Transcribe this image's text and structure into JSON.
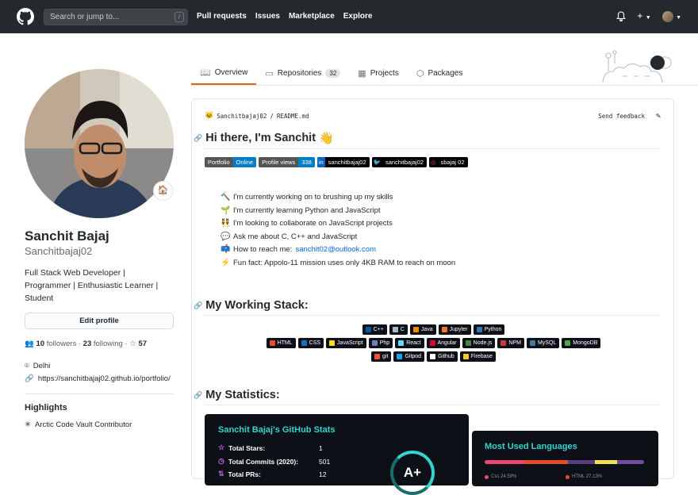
{
  "header": {
    "search_placeholder": "Search or jump to...",
    "search_shortcut": "/",
    "nav": [
      "Pull requests",
      "Issues",
      "Marketplace",
      "Explore"
    ]
  },
  "tabs": [
    {
      "label": "Overview",
      "active": true
    },
    {
      "label": "Repositories",
      "count": "32"
    },
    {
      "label": "Projects"
    },
    {
      "label": "Packages"
    }
  ],
  "profile": {
    "name": "Sanchit Bajaj",
    "login": "Sanchitbajaj02",
    "bio_lines": [
      "Full Stack Web Developer |",
      "Programmer | Enthusiastic Learner |",
      "Student"
    ],
    "edit_label": "Edit profile",
    "followers_count": "10",
    "followers_label": "followers",
    "following_count": "23",
    "following_label": "following",
    "stars": "57",
    "location": "Delhi",
    "website": "https://sanchitbajaj02.github.io/portfolio/",
    "highlights_title": "Highlights",
    "highlight": "Arctic Code Vault Contributor"
  },
  "readme": {
    "path_user": "Sanchitbajaj02",
    "path_sep": "/",
    "path_file": "README.md",
    "feedback": "Send feedback",
    "heading": "Hi there, I'm Sanchit",
    "badges": [
      {
        "left": "Portfolio",
        "right": "Online",
        "lcolor": "#555555",
        "rcolor": "#007ec6"
      },
      {
        "left": "Profile views",
        "right": "338",
        "lcolor": "#555555",
        "rcolor": "#007ec6"
      },
      {
        "left": "sanchitbajaj02",
        "color": "#0a66c2",
        "icon": "in"
      },
      {
        "left": "sanchitbajaj02",
        "color": "#1da1f2",
        "icon": "tw"
      },
      {
        "left": "sbajaj 02",
        "color": "#000000",
        "icon": "ig"
      }
    ],
    "bullets": [
      {
        "icon": "hammer",
        "text": "I'm currently working on to brushing up my skills"
      },
      {
        "icon": "seedling",
        "text": "I'm currently learning Python and JavaScript"
      },
      {
        "icon": "people",
        "text": "I'm looking to collaborate on JavaScript projects"
      },
      {
        "icon": "speech",
        "text": "Ask me about C, C++ and JavaScript"
      },
      {
        "icon": "mailbox",
        "text": "How to reach me: ",
        "link": "sanchit02@outlook.com"
      },
      {
        "icon": "zap",
        "text": "Fun fact: Appolo-11 mission uses only 4KB RAM to reach on moon"
      }
    ],
    "stack_heading": "My Working Stack:",
    "stack_rows": [
      [
        {
          "t": "C++",
          "c": "#00599c"
        },
        {
          "t": "C",
          "c": "#a8b9cc"
        },
        {
          "t": "Java",
          "c": "#ed8b00"
        },
        {
          "t": "Jupyter",
          "c": "#f37626"
        },
        {
          "t": "Python",
          "c": "#3776ab"
        }
      ],
      [
        {
          "t": "HTML",
          "c": "#e34f26"
        },
        {
          "t": "CSS",
          "c": "#1572b6"
        },
        {
          "t": "JavaScript",
          "c": "#f7df1e"
        },
        {
          "t": "Php",
          "c": "#777bb4"
        },
        {
          "t": "React",
          "c": "#61dafb"
        },
        {
          "t": "Angular",
          "c": "#dd0031"
        },
        {
          "t": "Node.js",
          "c": "#43853d"
        },
        {
          "t": "NPM",
          "c": "#cb3837"
        },
        {
          "t": "MySQL",
          "c": "#4479a1"
        },
        {
          "t": "MongoDB",
          "c": "#4ea94b"
        }
      ],
      [
        {
          "t": "git",
          "c": "#f05033"
        },
        {
          "t": "Gitpod",
          "c": "#1aa6e4"
        },
        {
          "t": "Github",
          "c": "#ffffff"
        },
        {
          "t": "Firebase",
          "c": "#ffca28"
        }
      ]
    ],
    "stats_heading": "My Statistics:",
    "stats": {
      "title": "Sanchit Bajaj's GitHub Stats",
      "rows": [
        {
          "label": "Total Stars:",
          "value": "1"
        },
        {
          "label": "Total Commits (2020):",
          "value": "501"
        },
        {
          "label": "Total PRs:",
          "value": "12"
        }
      ],
      "grade": "A+"
    },
    "languages": {
      "title": "Most Used Languages",
      "items": [
        {
          "name": "Css 24.59%",
          "color": "#e34c6f"
        },
        {
          "name": "HTML 27.13%",
          "color": "#e34c26"
        }
      ]
    }
  }
}
